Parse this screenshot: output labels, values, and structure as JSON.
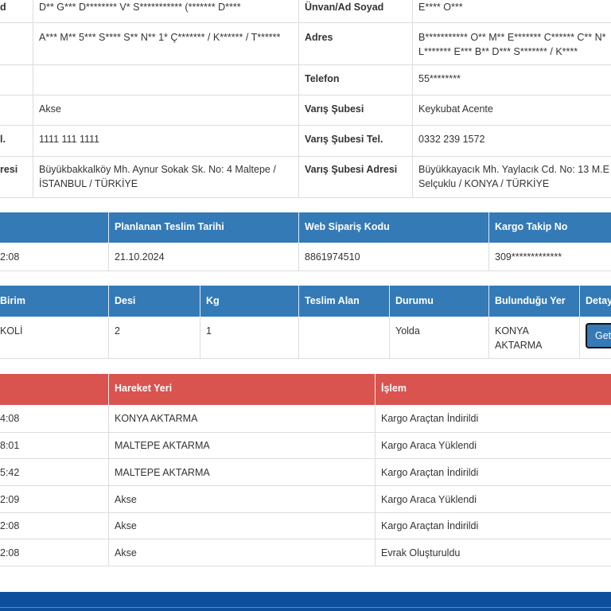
{
  "sender_receiver": {
    "name_label_partial": "d",
    "sender_name": "D** G*** D******** V* S*********** (******* D****",
    "receiver_name_label": "Ünvan/Ad Soyad",
    "receiver_name": "E**** O***",
    "sender_address": "A*** M** 5*** S**** S** N** 1* Ç******* / K****** / T******",
    "receiver_address_label": "Adres",
    "receiver_address_line1": "B*********** O** M** E******* C****** C** N*",
    "receiver_address_line2": "L******* E*** B** D*** S******* / K****",
    "receiver_phone_label": "Telefon",
    "receiver_phone": "55********",
    "origin_branch": "Akse",
    "dest_branch_label": "Varış Şubesi",
    "dest_branch": "Keykubat Acente",
    "origin_tel_label_partial": "l.",
    "origin_tel": "1111 111 1111",
    "dest_tel_label": "Varış Şubesi Tel.",
    "dest_tel": "0332 239 1572",
    "origin_addr_label_partial": "resi",
    "origin_address_line1": "Büyükbakkalköy Mh. Aynur Sokak Sk. No: 4 Maltepe /",
    "origin_address_line2": "İSTANBUL / TÜRKİYE",
    "dest_addr_label": "Varış Şubesi Adresi",
    "dest_address_line1": "Büyükkayacık Mh. Yaylacık Cd. No: 13 M.E",
    "dest_address_line2": "Selçuklu / KONYA / TÜRKİYE"
  },
  "order_info": {
    "headers": [
      "",
      "Planlanan Teslim Tarihi",
      "Web Sipariş Kodu",
      "Kargo Takip No"
    ],
    "row": [
      "2:08",
      "21.10.2024",
      "8861974510",
      "309*************"
    ]
  },
  "package_info": {
    "headers": [
      "Birim",
      "Desi",
      "Kg",
      "Teslim Alan",
      "Durumu",
      "Bulunduğu Yer",
      "Detay"
    ],
    "row": {
      "unit": "KOLİ",
      "desi": "2",
      "kg": "1",
      "received_by": "",
      "status": "Yolda",
      "location_line1": "KONYA",
      "location_line2": "AKTARMA",
      "detail_button": "Getir"
    }
  },
  "movements": {
    "headers": [
      "",
      "Hareket Yeri",
      "İşlem"
    ],
    "rows": [
      {
        "time": "4:08",
        "place": "KONYA AKTARMA",
        "action": "Kargo Araçtan İndirildi"
      },
      {
        "time": "8:01",
        "place": "MALTEPE AKTARMA",
        "action": "Kargo Araca Yüklendi"
      },
      {
        "time": "5:42",
        "place": "MALTEPE AKTARMA",
        "action": "Kargo Araçtan İndirildi"
      },
      {
        "time": "2:09",
        "place": "Akse",
        "action": "Kargo Araca Yüklendi"
      },
      {
        "time": "2:08",
        "place": "Akse",
        "action": "Kargo Araçtan İndirildi"
      },
      {
        "time": "2:08",
        "place": "Akse",
        "action": "Evrak Oluşturuldu"
      }
    ]
  },
  "colors": {
    "blue_header": "#337ab7",
    "red_header": "#d9534f",
    "footer": "#0d4f9d",
    "border": "#dddddd"
  }
}
